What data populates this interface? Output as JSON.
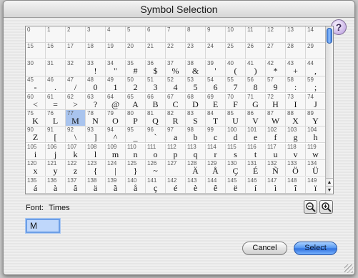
{
  "window": {
    "title": "Symbol Selection"
  },
  "help": {
    "label": "?"
  },
  "grid": {
    "columns": 15,
    "selected_code": 77,
    "cells": [
      {
        "code": "0",
        "char": ""
      },
      {
        "code": "1",
        "char": ""
      },
      {
        "code": "2",
        "char": ""
      },
      {
        "code": "3",
        "char": ""
      },
      {
        "code": "4",
        "char": ""
      },
      {
        "code": "5",
        "char": ""
      },
      {
        "code": "6",
        "char": ""
      },
      {
        "code": "7",
        "char": ""
      },
      {
        "code": "8",
        "char": ""
      },
      {
        "code": "9",
        "char": ""
      },
      {
        "code": "10",
        "char": ""
      },
      {
        "code": "11",
        "char": ""
      },
      {
        "code": "12",
        "char": ""
      },
      {
        "code": "13",
        "char": ""
      },
      {
        "code": "14",
        "char": ""
      },
      {
        "code": "15",
        "char": ""
      },
      {
        "code": "16",
        "char": ""
      },
      {
        "code": "17",
        "char": ""
      },
      {
        "code": "18",
        "char": ""
      },
      {
        "code": "19",
        "char": ""
      },
      {
        "code": "20",
        "char": ""
      },
      {
        "code": "21",
        "char": ""
      },
      {
        "code": "22",
        "char": ""
      },
      {
        "code": "23",
        "char": ""
      },
      {
        "code": "24",
        "char": ""
      },
      {
        "code": "25",
        "char": ""
      },
      {
        "code": "26",
        "char": ""
      },
      {
        "code": "27",
        "char": ""
      },
      {
        "code": "28",
        "char": ""
      },
      {
        "code": "29",
        "char": ""
      },
      {
        "code": "30",
        "char": ""
      },
      {
        "code": "31",
        "char": ""
      },
      {
        "code": "32",
        "char": ""
      },
      {
        "code": "33",
        "char": "!"
      },
      {
        "code": "34",
        "char": "\""
      },
      {
        "code": "35",
        "char": "#"
      },
      {
        "code": "36",
        "char": "$"
      },
      {
        "code": "37",
        "char": "%"
      },
      {
        "code": "38",
        "char": "&"
      },
      {
        "code": "39",
        "char": "'"
      },
      {
        "code": "40",
        "char": "("
      },
      {
        "code": "41",
        "char": ")"
      },
      {
        "code": "42",
        "char": "*"
      },
      {
        "code": "43",
        "char": "+"
      },
      {
        "code": "44",
        "char": ","
      },
      {
        "code": "45",
        "char": "-"
      },
      {
        "code": "46",
        "char": "."
      },
      {
        "code": "47",
        "char": "/"
      },
      {
        "code": "48",
        "char": "0"
      },
      {
        "code": "49",
        "char": "1"
      },
      {
        "code": "50",
        "char": "2"
      },
      {
        "code": "51",
        "char": "3"
      },
      {
        "code": "52",
        "char": "4"
      },
      {
        "code": "53",
        "char": "5"
      },
      {
        "code": "54",
        "char": "6"
      },
      {
        "code": "55",
        "char": "7"
      },
      {
        "code": "56",
        "char": "8"
      },
      {
        "code": "57",
        "char": "9"
      },
      {
        "code": "58",
        "char": ":"
      },
      {
        "code": "59",
        "char": ";"
      },
      {
        "code": "60",
        "char": "<"
      },
      {
        "code": "61",
        "char": "="
      },
      {
        "code": "62",
        "char": ">"
      },
      {
        "code": "63",
        "char": "?"
      },
      {
        "code": "64",
        "char": "@"
      },
      {
        "code": "65",
        "char": "A"
      },
      {
        "code": "66",
        "char": "B"
      },
      {
        "code": "67",
        "char": "C"
      },
      {
        "code": "68",
        "char": "D"
      },
      {
        "code": "69",
        "char": "E"
      },
      {
        "code": "70",
        "char": "F"
      },
      {
        "code": "71",
        "char": "G"
      },
      {
        "code": "72",
        "char": "H"
      },
      {
        "code": "73",
        "char": "I"
      },
      {
        "code": "74",
        "char": "J"
      },
      {
        "code": "75",
        "char": "K"
      },
      {
        "code": "76",
        "char": "L"
      },
      {
        "code": "77",
        "char": "M"
      },
      {
        "code": "78",
        "char": "N"
      },
      {
        "code": "79",
        "char": "O"
      },
      {
        "code": "80",
        "char": "P"
      },
      {
        "code": "81",
        "char": "Q"
      },
      {
        "code": "82",
        "char": "R"
      },
      {
        "code": "83",
        "char": "S"
      },
      {
        "code": "84",
        "char": "T"
      },
      {
        "code": "85",
        "char": "U"
      },
      {
        "code": "86",
        "char": "V"
      },
      {
        "code": "87",
        "char": "W"
      },
      {
        "code": "88",
        "char": "X"
      },
      {
        "code": "89",
        "char": "Y"
      },
      {
        "code": "90",
        "char": "Z"
      },
      {
        "code": "91",
        "char": "["
      },
      {
        "code": "92",
        "char": "\\"
      },
      {
        "code": "93",
        "char": "]"
      },
      {
        "code": "94",
        "char": "^"
      },
      {
        "code": "95",
        "char": "_"
      },
      {
        "code": "96",
        "char": "`"
      },
      {
        "code": "97",
        "char": "a"
      },
      {
        "code": "98",
        "char": "b"
      },
      {
        "code": "99",
        "char": "c"
      },
      {
        "code": "100",
        "char": "d"
      },
      {
        "code": "101",
        "char": "e"
      },
      {
        "code": "102",
        "char": "f"
      },
      {
        "code": "103",
        "char": "g"
      },
      {
        "code": "104",
        "char": "h"
      },
      {
        "code": "105",
        "char": "i"
      },
      {
        "code": "106",
        "char": "j"
      },
      {
        "code": "107",
        "char": "k"
      },
      {
        "code": "108",
        "char": "l"
      },
      {
        "code": "109",
        "char": "m"
      },
      {
        "code": "110",
        "char": "n"
      },
      {
        "code": "111",
        "char": "o"
      },
      {
        "code": "112",
        "char": "p"
      },
      {
        "code": "113",
        "char": "q"
      },
      {
        "code": "114",
        "char": "r"
      },
      {
        "code": "115",
        "char": "s"
      },
      {
        "code": "116",
        "char": "t"
      },
      {
        "code": "117",
        "char": "u"
      },
      {
        "code": "118",
        "char": "v"
      },
      {
        "code": "119",
        "char": "w"
      },
      {
        "code": "120",
        "char": "x"
      },
      {
        "code": "121",
        "char": "y"
      },
      {
        "code": "122",
        "char": "z"
      },
      {
        "code": "123",
        "char": "{"
      },
      {
        "code": "124",
        "char": "|"
      },
      {
        "code": "125",
        "char": "}"
      },
      {
        "code": "126",
        "char": "~"
      },
      {
        "code": "127",
        "char": ""
      },
      {
        "code": "128",
        "char": "Ä"
      },
      {
        "code": "129",
        "char": "Å"
      },
      {
        "code": "130",
        "char": "Ç"
      },
      {
        "code": "131",
        "char": "É"
      },
      {
        "code": "132",
        "char": "Ñ"
      },
      {
        "code": "133",
        "char": "Ö"
      },
      {
        "code": "134",
        "char": "Ü"
      },
      {
        "code": "135",
        "char": "á"
      },
      {
        "code": "136",
        "char": "à"
      },
      {
        "code": "137",
        "char": "â"
      },
      {
        "code": "138",
        "char": "ä"
      },
      {
        "code": "139",
        "char": "ã"
      },
      {
        "code": "140",
        "char": "å"
      },
      {
        "code": "141",
        "char": "ç"
      },
      {
        "code": "142",
        "char": "é"
      },
      {
        "code": "143",
        "char": "è"
      },
      {
        "code": "144",
        "char": "ê"
      },
      {
        "code": "145",
        "char": "ë"
      },
      {
        "code": "146",
        "char": "í"
      },
      {
        "code": "147",
        "char": "ì"
      },
      {
        "code": "148",
        "char": "î"
      },
      {
        "code": "149",
        "char": "ï"
      }
    ]
  },
  "scrollbar": {
    "up_arrow": "▲",
    "down_arrow": "▼"
  },
  "font": {
    "label": "Font:",
    "name": "Times"
  },
  "zoom": {
    "out_icon": "zoom-out-icon",
    "in_icon": "zoom-in-icon"
  },
  "selected_char": "M",
  "buttons": {
    "cancel": "Cancel",
    "select": "Select"
  },
  "colors": {
    "selection": "#a9c4ee",
    "default_button": "#4f93f0"
  }
}
